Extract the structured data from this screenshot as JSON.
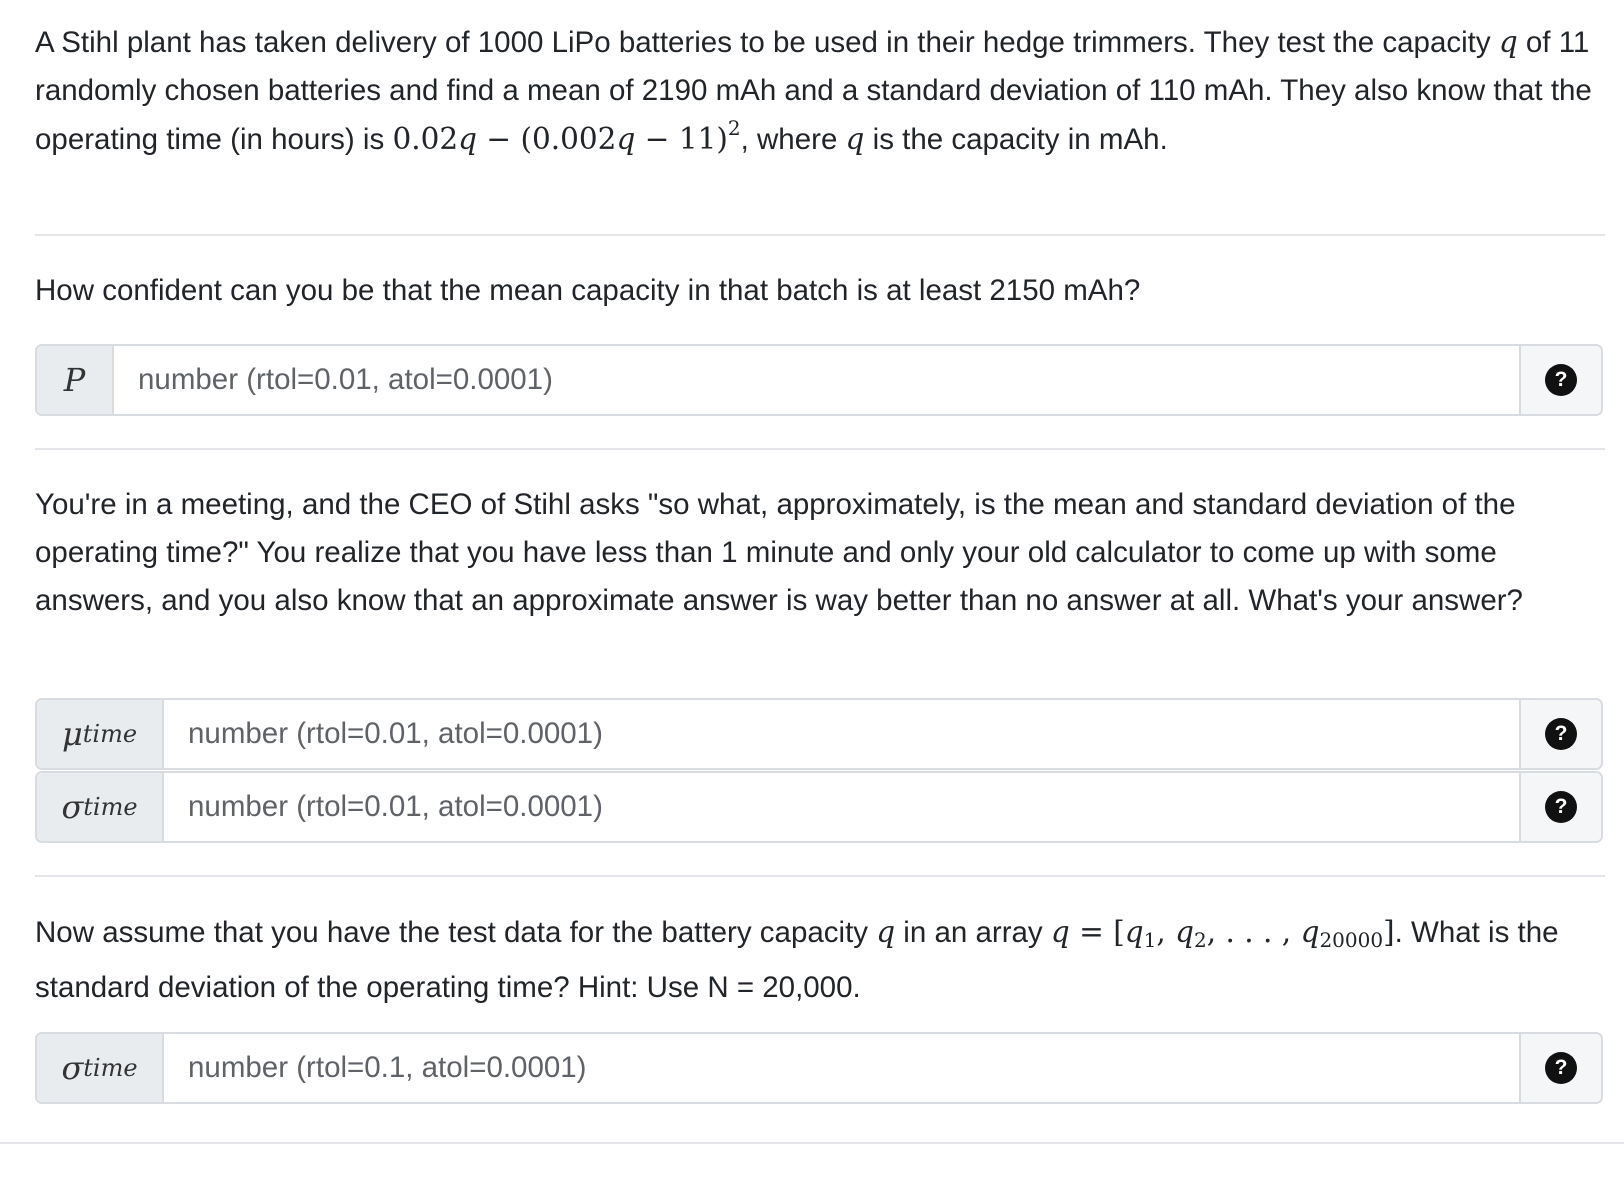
{
  "intro": {
    "t1": "A Stihl plant has taken delivery of 1000 LiPo batteries to be used in their hedge trimmers. They test the capacity ",
    "var_q": "q",
    "t2": " of 11 randomly chosen batteries and find a mean of 2190 mAh and a standard deviation of 110 mAh. They also know that the operating time (in hours) is ",
    "f_a": "0.02",
    "f_b": " − (0.002",
    "f_c": " − 11)",
    "f_exp": "2",
    "t3": ", where ",
    "t4": " is the capacity in mAh."
  },
  "q1": {
    "text": "How confident can you be that the mean capacity in that batch is at least 2150 mAh?",
    "prefix": "P",
    "placeholder": "number (rtol=0.01, atol=0.0001)",
    "help": "?"
  },
  "q2": {
    "text": "You're in a meeting, and the CEO of Stihl asks \"so what, approximately, is the mean and standard deviation of the operating time?\" You realize that you have less than 1 minute and only your old calculator to come up with some answers, and you also know that an approximate answer is way better than no answer at all. What's your answer?",
    "mu_sym": "μ",
    "mu_sub": "time",
    "mu_placeholder": "number (rtol=0.01, atol=0.0001)",
    "sigma_sym": "σ",
    "sigma_sub": "time",
    "sigma_placeholder": "number (rtol=0.01, atol=0.0001)",
    "help": "?"
  },
  "q3": {
    "t1": "Now assume that you have the test data for the battery capacity ",
    "var_q": "q",
    "t2": " in an array ",
    "arr_lhs": "q",
    "arr_eq": " = [",
    "arr_q": "q",
    "s1": "1",
    "comma": ", ",
    "s2": "2",
    "dots": ", . . . , ",
    "sN": "20000",
    "arr_close": "]",
    "t3": ". What is the standard deviation of the operating time? Hint: Use N = 20,000.",
    "sigma_sym": "σ",
    "sigma_sub": "time",
    "placeholder": "number (rtol=0.1, atol=0.0001)",
    "help": "?"
  }
}
